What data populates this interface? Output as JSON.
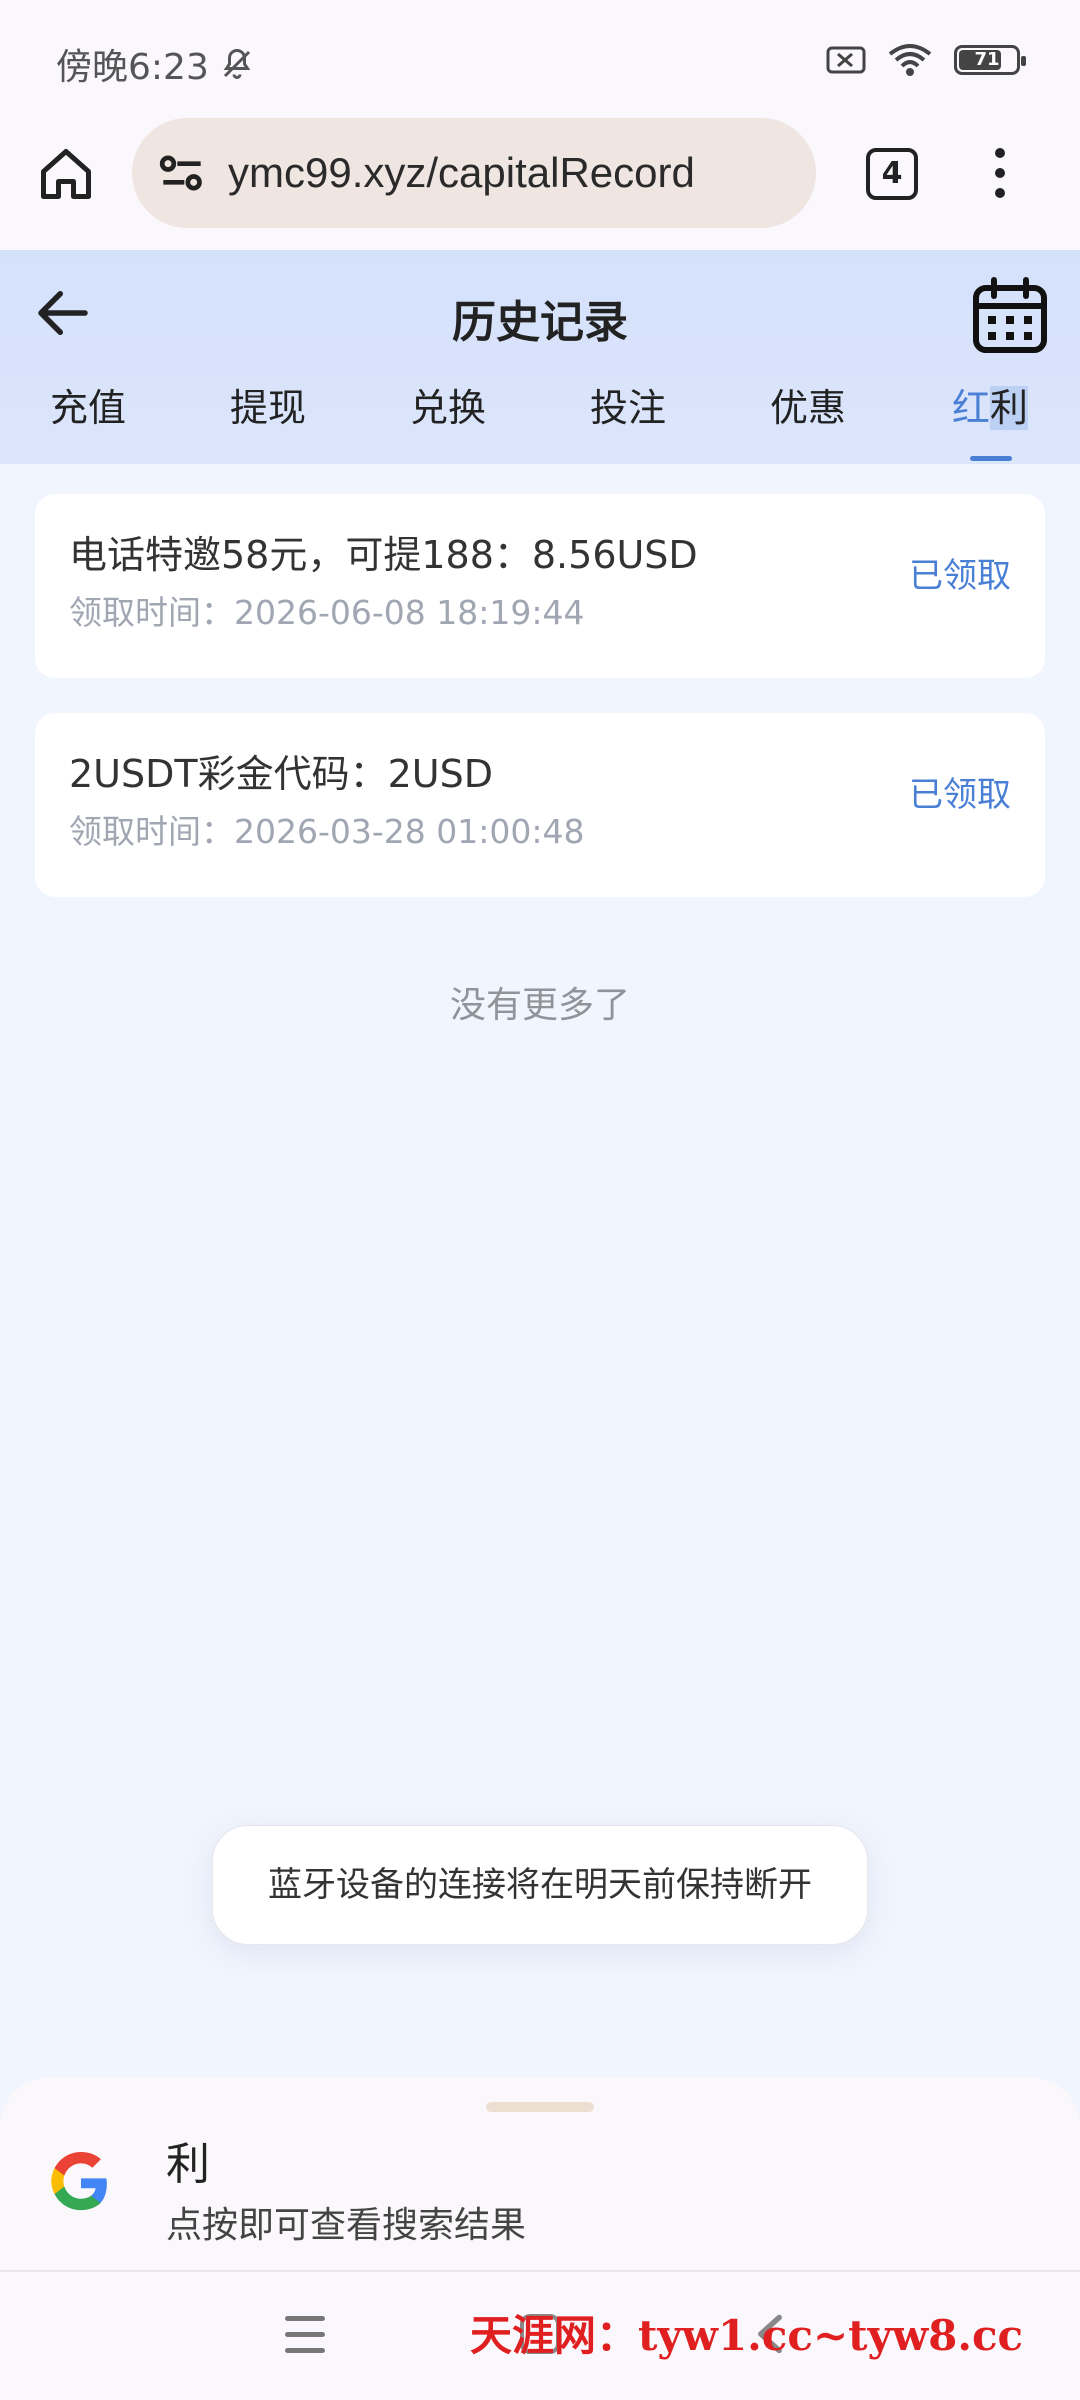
{
  "status_bar": {
    "time": "傍晚6:23",
    "battery": "71"
  },
  "browser": {
    "url": "ymc99.xyz/capitalRecord",
    "tab_count": "4"
  },
  "header": {
    "title": "历史记录",
    "tabs": [
      {
        "label": "充值"
      },
      {
        "label": "提现"
      },
      {
        "label": "兑换"
      },
      {
        "label": "投注"
      },
      {
        "label": "优惠"
      },
      {
        "label_a": "红",
        "label_b": "利",
        "active": true
      }
    ]
  },
  "records": [
    {
      "title": "电话特邀58元，可提188：8.56USD",
      "time": "领取时间：2026-06-08 18:19:44",
      "status": "已领取"
    },
    {
      "title": "2USDT彩金代码：2USD",
      "time": "领取时间：2026-03-28 01:00:48",
      "status": "已领取"
    }
  ],
  "list_end": "没有更多了",
  "toast": "蓝牙设备的连接将在明天前保持断开",
  "search_sheet": {
    "query": "利",
    "hint": "点按即可查看搜索结果"
  },
  "watermark": "天涯网：tyw1.cc~tyw8.cc",
  "colors": {
    "accent": "#4a7fd6",
    "header_bg": "#d5e1fb",
    "page_bg": "#f1f5fd"
  }
}
